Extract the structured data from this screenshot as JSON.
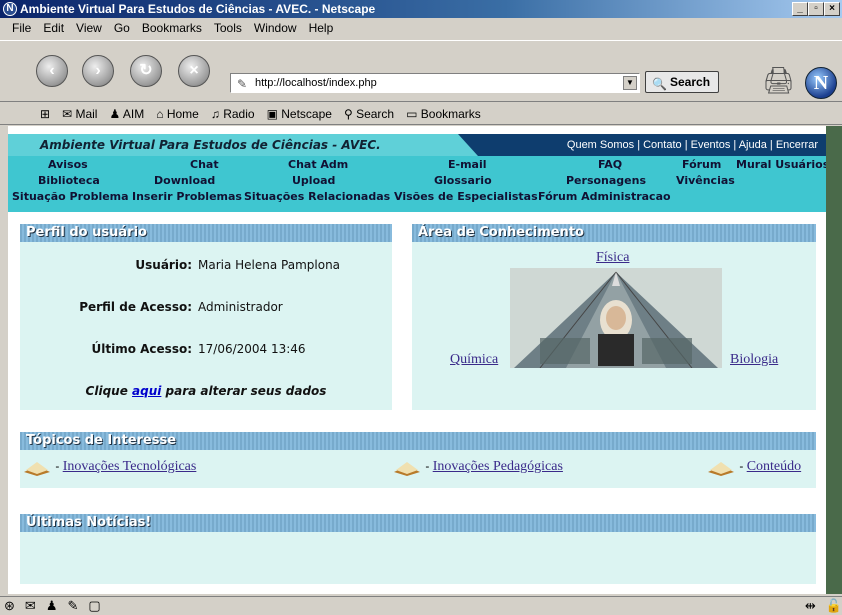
{
  "window": {
    "title": "Ambiente Virtual Para Estudos de Ciências - AVEC. - Netscape"
  },
  "menu": [
    "File",
    "Edit",
    "View",
    "Go",
    "Bookmarks",
    "Tools",
    "Window",
    "Help"
  ],
  "toolbar": {
    "url": "http://localhost/index.php",
    "search_label": "Search"
  },
  "personal_toolbar": [
    "Mail",
    "AIM",
    "Home",
    "Radio",
    "Netscape",
    "Search",
    "Bookmarks"
  ],
  "site": {
    "title": "Ambiente Virtual Para Estudos de Ciências - AVEC.",
    "topmenu": "Quem Somos | Contato | Eventos | Ajuda | Encerrar",
    "nav_row1": [
      "Avisos",
      "Chat",
      "Chat Adm",
      "E-mail",
      "FAQ",
      "Fórum",
      "Mural Usuários"
    ],
    "nav_row2": [
      "Biblioteca",
      "Download",
      "Upload",
      "Glossario",
      "Personagens",
      "Vivências"
    ],
    "nav_row3": [
      "Situação Problema",
      "Inserir Problemas",
      "Situações Relacionadas",
      "Visões de Especialistas",
      "Fórum Administracao"
    ]
  },
  "perfil": {
    "heading": "Perfil do usuário",
    "usuario_label": "Usuário:",
    "usuario_value": "Maria Helena Pamplona",
    "acesso_label": "Perfil de Acesso:",
    "acesso_value": "Administrador",
    "ultimo_label": "Último Acesso:",
    "ultimo_value": "17/06/2004 13:46",
    "clique_pre": "Clique ",
    "clique_link": "aqui",
    "clique_post": " para alterar seus dados"
  },
  "area": {
    "heading": "Área de Conhecimento",
    "fisica": "Física",
    "quimica": "Química",
    "biologia": "Biologia"
  },
  "topicos": {
    "heading": "Tópicos de Interesse",
    "items": [
      "Inovações Tecnológicas",
      "Inovações Pedagógicas",
      "Conteúdo"
    ],
    "sep": "- "
  },
  "noticias": {
    "heading": "Últimas Notícias!"
  }
}
